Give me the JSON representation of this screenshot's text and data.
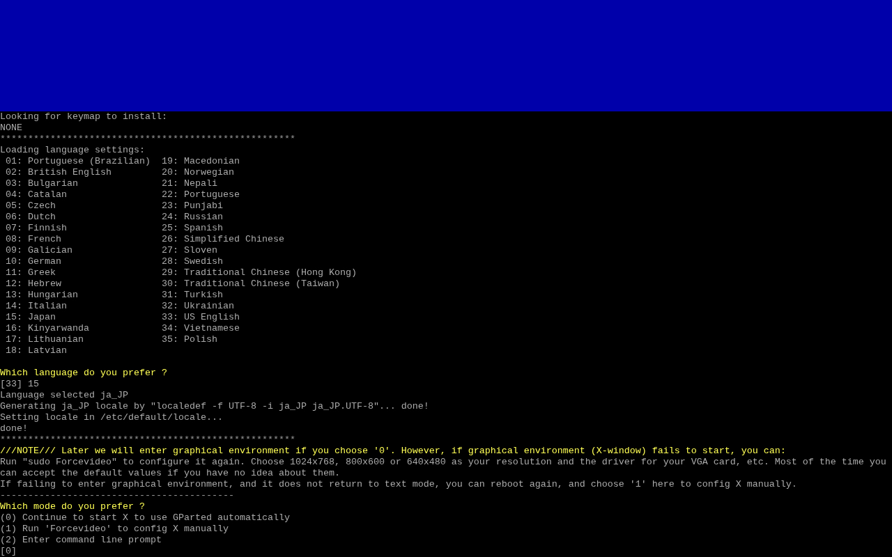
{
  "log_top": [
    {
      "kind": "text",
      "text": "Looking for keymap to install:"
    },
    {
      "kind": "text",
      "text": "NONE"
    },
    {
      "kind": "rule",
      "text": "*****************************************************"
    },
    {
      "kind": "text",
      "text": "Loading language settings:"
    }
  ],
  "languages": {
    "left": [
      "01: Portuguese (Brazilian)",
      "02: British English",
      "03: Bulgarian",
      "04: Catalan",
      "05: Czech",
      "06: Dutch",
      "07: Finnish",
      "08: French",
      "09: Galician",
      "10: German",
      "11: Greek",
      "12: Hebrew",
      "13: Hungarian",
      "14: Italian",
      "15: Japan",
      "16: Kinyarwanda",
      "17: Lithuanian",
      "18: Latvian"
    ],
    "right": [
      "19: Macedonian",
      "20: Norwegian",
      "21: Nepali",
      "22: Portuguese",
      "23: Punjabi",
      "24: Russian",
      "25: Spanish",
      "26: Simplified Chinese",
      "27: Sloven",
      "28: Swedish",
      "29: Traditional Chinese (Hong Kong)",
      "30: Traditional Chinese (Taiwan)",
      "31: Turkish",
      "32: Ukrainian",
      "33: US English",
      "34: Vietnamese",
      "35: Polish"
    ]
  },
  "log": [
    {
      "kind": "prompt",
      "text": "Which language do you prefer ?"
    },
    {
      "kind": "text",
      "text": "[33] 15"
    },
    {
      "kind": "text",
      "text": "Language selected ja_JP"
    },
    {
      "kind": "text",
      "text": "Generating ja_JP locale by \"localedef -f UTF-8 -i ja_JP ja_JP.UTF-8\"... done!"
    },
    {
      "kind": "text",
      "text": "Setting locale in /etc/default/locale..."
    },
    {
      "kind": "text",
      "text": "done!"
    },
    {
      "kind": "rule",
      "text": "*****************************************************"
    },
    {
      "kind": "prompt",
      "text": "///NOTE/// Later we will enter graphical environment if you choose '0'. However, if graphical environment (X-window) fails to start, you can:"
    },
    {
      "kind": "text",
      "text": "Run \"sudo Forcevideo\" to configure it again. Choose 1024x768, 800x600 or 640x480 as your resolution and the driver for your VGA card, etc. Most of the time you can accept the default values if you have no idea about them."
    },
    {
      "kind": "text",
      "text": "If failing to enter graphical environment, and it does not return to text mode, you can reboot again, and choose '1' here to config X manually."
    },
    {
      "kind": "rule",
      "text": "------------------------------------------"
    },
    {
      "kind": "prompt",
      "text": "Which mode do you prefer ?"
    },
    {
      "kind": "text",
      "text": "(0) Continue to start X to use GParted automatically"
    },
    {
      "kind": "text",
      "text": "(1) Run 'Forcevideo' to config X manually"
    },
    {
      "kind": "text",
      "text": "(2) Enter command line prompt"
    },
    {
      "kind": "text",
      "text": "[0]"
    }
  ]
}
